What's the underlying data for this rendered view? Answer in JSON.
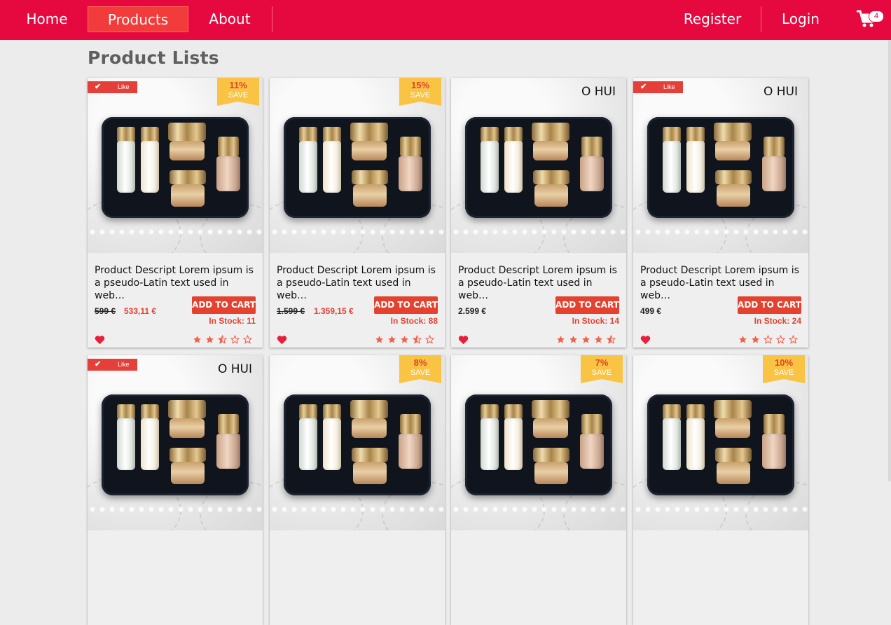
{
  "nav": {
    "home": "Home",
    "products": "Products",
    "about": "About",
    "register": "Register",
    "login": "Login",
    "cart_count": "4"
  },
  "page": {
    "title": "Product Lists"
  },
  "colors": {
    "brand": "#e6093f",
    "accent": "#e5412f",
    "ribbon": "#f9c343"
  },
  "products": [
    {
      "liked": true,
      "badge": "save",
      "save_pct": "11%",
      "save_label": "SAVE",
      "brand": "",
      "description": "Product Descript Lorem ipsum is a pseudo-Latin text used in web…",
      "old_price": "599 €",
      "new_price": "533,11 €",
      "price": "",
      "add_to_cart": "ADD TO CART",
      "stock": "In Stock: 11",
      "rating": 2.5
    },
    {
      "liked": false,
      "badge": "save",
      "save_pct": "15%",
      "save_label": "SAVE",
      "brand": "",
      "description": "Product Descript Lorem ipsum is a pseudo-Latin text used in web…",
      "old_price": "1.599 €",
      "new_price": "1.359,15 €",
      "price": "",
      "add_to_cart": "ADD TO CART",
      "stock": "In Stock: 88",
      "rating": 3.5
    },
    {
      "liked": false,
      "badge": "brand",
      "save_pct": "",
      "save_label": "",
      "brand": "O HUI",
      "description": "Product Descript Lorem ipsum is a pseudo-Latin text used in web…",
      "old_price": "",
      "new_price": "",
      "price": "2.599 €",
      "add_to_cart": "ADD TO CART",
      "stock": "In Stock: 14",
      "rating": 4.5
    },
    {
      "liked": true,
      "badge": "brand",
      "save_pct": "",
      "save_label": "",
      "brand": "O HUI",
      "description": "Product Descript Lorem ipsum is a pseudo-Latin text used in web…",
      "old_price": "",
      "new_price": "",
      "price": "499 €",
      "add_to_cart": "ADD TO CART",
      "stock": "In Stock: 24",
      "rating": 2
    },
    {
      "liked": true,
      "badge": "brand",
      "save_pct": "",
      "save_label": "",
      "brand": "O HUI"
    },
    {
      "liked": false,
      "badge": "save",
      "save_pct": "8%",
      "save_label": "SAVE",
      "brand": ""
    },
    {
      "liked": false,
      "badge": "save",
      "save_pct": "7%",
      "save_label": "SAVE",
      "brand": ""
    },
    {
      "liked": false,
      "badge": "save",
      "save_pct": "10%",
      "save_label": "SAVE",
      "brand": ""
    }
  ],
  "like_label": "Like"
}
